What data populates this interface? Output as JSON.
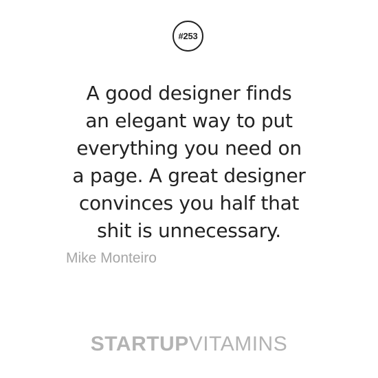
{
  "badge": {
    "label": "#253"
  },
  "quote": {
    "lines": [
      "A good designer finds",
      "an elegant way to put",
      "everything you need on",
      "a page. A great designer",
      "convinces you half that",
      "shit is unnecessary."
    ]
  },
  "author": {
    "name": "Mike Monteiro"
  },
  "brand": {
    "part_bold": "STARTUP",
    "part_light": "VITAMINS"
  },
  "colors": {
    "text": "#222222",
    "author": "#a6a6a6",
    "brand": "#b3b3b3",
    "background": "#ffffff"
  }
}
